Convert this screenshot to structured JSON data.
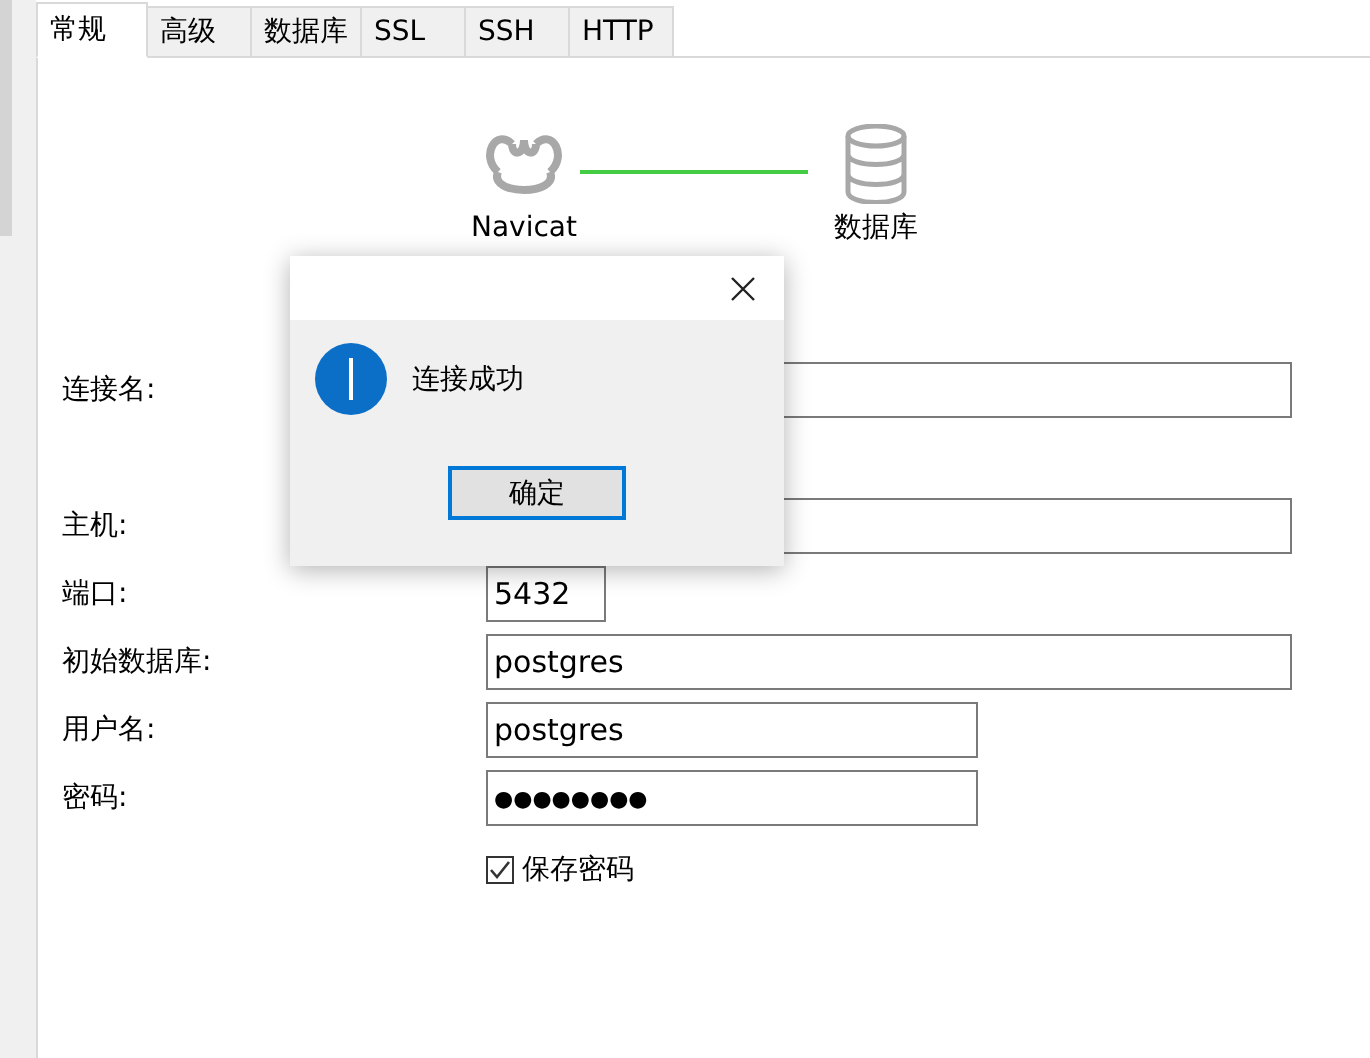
{
  "tabs": [
    {
      "label": "常规",
      "selected": true
    },
    {
      "label": "高级",
      "selected": false
    },
    {
      "label": "数据库",
      "selected": false
    },
    {
      "label": "SSL",
      "selected": false
    },
    {
      "label": "SSH",
      "selected": false
    },
    {
      "label": "HTTP",
      "selected": false
    }
  ],
  "diagram": {
    "source_label": "Navicat",
    "target_label": "数据库"
  },
  "form": [
    {
      "label": "连接名:",
      "kind": "field"
    },
    {
      "kind": "spacer"
    },
    {
      "label": "主机:",
      "kind": "field"
    },
    {
      "label": "端口:",
      "kind": "field",
      "value": "5432"
    },
    {
      "label": "初始数据库:",
      "kind": "field",
      "value": "postgres"
    },
    {
      "label": "用户名:",
      "kind": "field",
      "value": "postgres"
    },
    {
      "label": "密码:",
      "kind": "password",
      "value": "●●●●●●●●"
    },
    {
      "label": "保存密码",
      "kind": "checkbox",
      "checked": true
    }
  ],
  "dialog": {
    "message": "连接成功",
    "button": "确定"
  }
}
